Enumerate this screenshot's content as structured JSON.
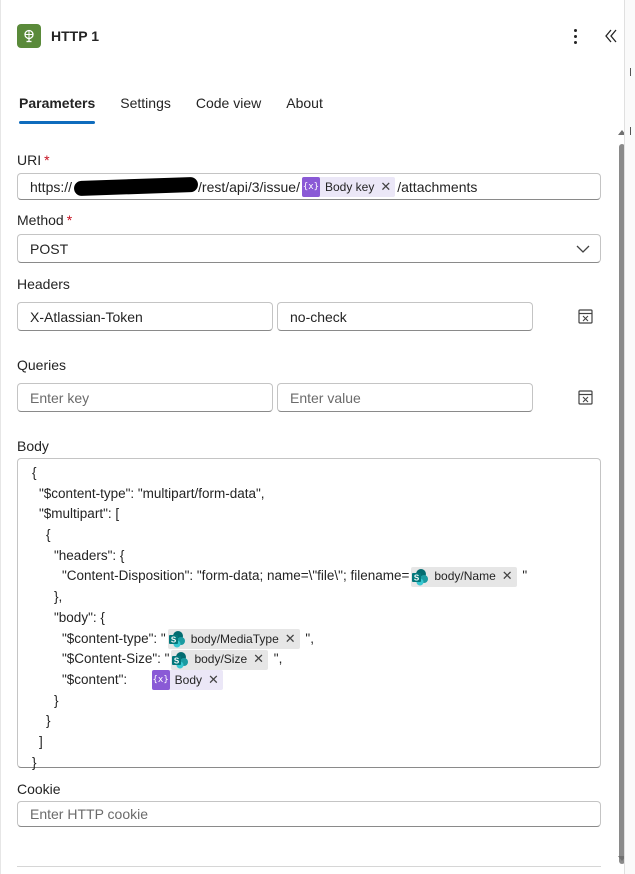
{
  "header": {
    "title": "HTTP 1",
    "logo_icon": "globe-icon",
    "logo_color": "#5a8a3a",
    "more_icon": "more-vertical-icon",
    "collapse_icon": "double-chevron-left-icon"
  },
  "tabs": [
    {
      "label": "Parameters",
      "active": true
    },
    {
      "label": "Settings",
      "active": false
    },
    {
      "label": "Code view",
      "active": false
    },
    {
      "label": "About",
      "active": false
    }
  ],
  "accent_color": "#0f6cbd",
  "uri": {
    "label": "URI",
    "required_mark": "*",
    "prefix": "https://",
    "middle": "/rest/api/3/issue/",
    "token": {
      "label": "Body key",
      "icon": "variable-icon"
    },
    "suffix": "/attachments"
  },
  "method": {
    "label": "Method",
    "required_mark": "*",
    "value": "POST"
  },
  "headers": {
    "label": "Headers",
    "key": "X-Atlassian-Token",
    "value": "no-check",
    "delete_icon": "delete-row-icon"
  },
  "queries": {
    "label": "Queries",
    "key_placeholder": "Enter key",
    "value_placeholder": "Enter value",
    "delete_icon": "delete-row-icon"
  },
  "body": {
    "label": "Body",
    "lines": {
      "l1": "{",
      "l2": "\"$content-type\": \"multipart/form-data\",",
      "l3": "\"$multipart\": [",
      "l4": "{",
      "l5": "\"headers\": {",
      "l6_text": "\"Content-Disposition\": \"form-data; name=\\\"file\\\"; filename=",
      "l6_token": "body/Name",
      "l6_tail": " \"",
      "l7": "},",
      "l8": "\"body\": {",
      "l9_text": "\"$content-type\": \"",
      "l9_token": "body/MediaType",
      "l9_tail": " \",",
      "l10_text": "\"$Content-Size\": \"",
      "l10_token": "body/Size",
      "l10_tail": " \",",
      "l11_text": "\"$content\":",
      "l11_token": "Body",
      "l12": "}",
      "l13": "}",
      "l14": "]",
      "l15": "}"
    },
    "sharepoint_icon": "sharepoint-icon",
    "variable_icon": "variable-icon"
  },
  "cookie": {
    "label": "Cookie",
    "placeholder": "Enter HTTP cookie"
  },
  "close_glyph": "✕"
}
